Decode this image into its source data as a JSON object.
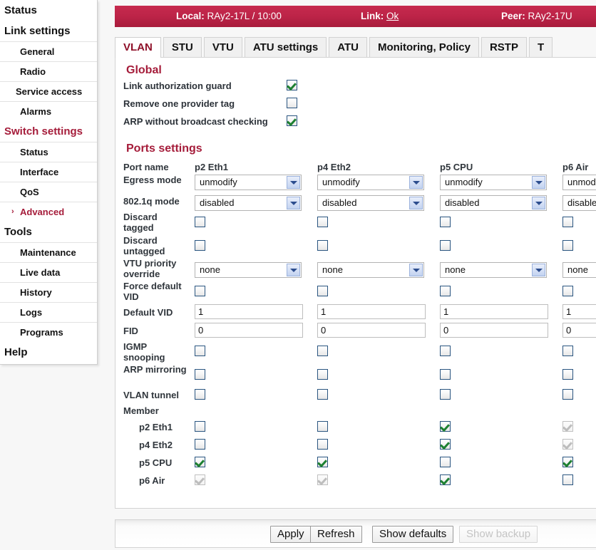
{
  "statusbar": {
    "local_label": "Local:",
    "local_value": "RAy2-17L / 10:00",
    "link_label": "Link:",
    "link_value": "Ok",
    "peer_label": "Peer:",
    "peer_value": "RAy2-17U",
    "background_color": "#bd2448"
  },
  "sidebar": {
    "items": [
      {
        "label": "Status",
        "type": "group",
        "selected": false
      },
      {
        "label": "Link settings",
        "type": "group",
        "selected": false
      },
      {
        "label": "General",
        "type": "item",
        "selected": false
      },
      {
        "label": "Radio",
        "type": "item",
        "selected": false
      },
      {
        "label": "Service access",
        "type": "item",
        "selected": false
      },
      {
        "label": "Alarms",
        "type": "item",
        "selected": false
      },
      {
        "label": "Switch settings",
        "type": "group-accent",
        "selected": false
      },
      {
        "label": "Status",
        "type": "item",
        "selected": false
      },
      {
        "label": "Interface",
        "type": "item",
        "selected": false
      },
      {
        "label": "QoS",
        "type": "item",
        "selected": false
      },
      {
        "label": "Advanced",
        "type": "item",
        "selected": true
      },
      {
        "label": "Tools",
        "type": "group",
        "selected": false
      },
      {
        "label": "Maintenance",
        "type": "item",
        "selected": false
      },
      {
        "label": "Live data",
        "type": "item",
        "selected": false
      },
      {
        "label": "History",
        "type": "item",
        "selected": false
      },
      {
        "label": "Logs",
        "type": "item",
        "selected": false
      },
      {
        "label": "Programs",
        "type": "item",
        "selected": false
      },
      {
        "label": "Help",
        "type": "group",
        "selected": false
      }
    ],
    "selected_marker": "›",
    "accent_color": "#a51c3a"
  },
  "tabs": {
    "items": [
      {
        "label": "VLAN",
        "active": true
      },
      {
        "label": "STU",
        "active": false
      },
      {
        "label": "VTU",
        "active": false
      },
      {
        "label": "ATU settings",
        "active": false
      },
      {
        "label": "ATU",
        "active": false
      },
      {
        "label": "Monitoring, Policy",
        "active": false
      },
      {
        "label": "RSTP",
        "active": false
      },
      {
        "label": "T",
        "active": false
      }
    ],
    "active_color": "#8f1029"
  },
  "global": {
    "title": "Global",
    "rows": [
      {
        "label": "Link authorization guard",
        "checked": true,
        "disabled": false
      },
      {
        "label": "Remove one provider tag",
        "checked": false,
        "disabled": false
      },
      {
        "label": "ARP without broadcast checking",
        "checked": true,
        "disabled": false
      }
    ]
  },
  "ports": {
    "title": "Ports settings",
    "columns": [
      "p2 Eth1",
      "p4 Eth2",
      "p5 CPU",
      "p6 Air"
    ],
    "labels": {
      "port_name": "Port name",
      "egress_mode": "Egress mode",
      "dot1q_mode": "802.1q mode",
      "discard_tagged": "Discard tagged",
      "discard_untagged": "Discard untagged",
      "vtu_priority_override": "VTU priority override",
      "force_default_vid": "Force default VID",
      "default_vid": "Default VID",
      "fid": "FID",
      "igmp_snooping": "IGMP snooping",
      "arp_mirroring": "ARP mirroring",
      "vlan_tunnel": "VLAN tunnel",
      "member": "Member"
    },
    "egress_mode": [
      "unmodify",
      "unmodify",
      "unmodify",
      "unmodify"
    ],
    "dot1q_mode": [
      "disabled",
      "disabled",
      "disabled",
      "disabled"
    ],
    "discard_tagged": [
      false,
      false,
      false,
      false
    ],
    "discard_untagged": [
      false,
      false,
      false,
      false
    ],
    "vtu_priority_override": [
      "none",
      "none",
      "none",
      "none"
    ],
    "force_default_vid": [
      false,
      false,
      false,
      false
    ],
    "default_vid": [
      "1",
      "1",
      "1",
      "1"
    ],
    "fid": [
      "0",
      "0",
      "0",
      "0"
    ],
    "igmp_snooping": [
      false,
      false,
      false,
      false
    ],
    "arp_mirroring": [
      false,
      false,
      false,
      false
    ],
    "vlan_tunnel": [
      false,
      false,
      false,
      false
    ],
    "member_rows": [
      {
        "label": "p2 Eth1",
        "values": [
          {
            "checked": false,
            "disabled": false
          },
          {
            "checked": false,
            "disabled": false
          },
          {
            "checked": true,
            "disabled": false
          },
          {
            "checked": true,
            "disabled": true
          }
        ]
      },
      {
        "label": "p4 Eth2",
        "values": [
          {
            "checked": false,
            "disabled": false
          },
          {
            "checked": false,
            "disabled": false
          },
          {
            "checked": true,
            "disabled": false
          },
          {
            "checked": true,
            "disabled": true
          }
        ]
      },
      {
        "label": "p5 CPU",
        "values": [
          {
            "checked": true,
            "disabled": false
          },
          {
            "checked": true,
            "disabled": false
          },
          {
            "checked": false,
            "disabled": false
          },
          {
            "checked": true,
            "disabled": false
          }
        ]
      },
      {
        "label": "p6 Air",
        "values": [
          {
            "checked": true,
            "disabled": true
          },
          {
            "checked": true,
            "disabled": true
          },
          {
            "checked": true,
            "disabled": false
          },
          {
            "checked": false,
            "disabled": false
          }
        ]
      }
    ]
  },
  "buttons": [
    {
      "label": "Apply",
      "disabled": false
    },
    {
      "label": "Refresh",
      "disabled": false
    },
    {
      "label": "Show defaults",
      "disabled": false
    },
    {
      "label": "Show backup",
      "disabled": true
    }
  ]
}
